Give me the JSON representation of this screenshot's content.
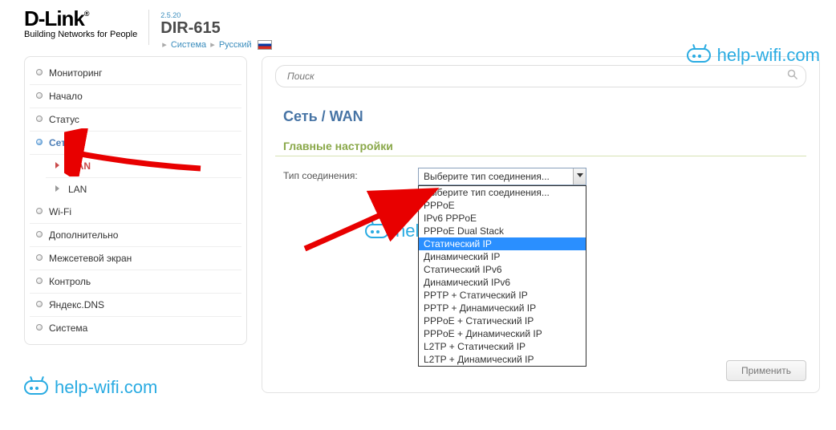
{
  "header": {
    "brand": "D-Link",
    "brand_reg": "®",
    "tagline": "Building Networks for People",
    "version": "2.5.20",
    "model": "DIR-615",
    "crumb1": "Система",
    "crumb2": "Русский"
  },
  "sidebar": {
    "items": [
      {
        "label": "Мониторинг"
      },
      {
        "label": "Начало"
      },
      {
        "label": "Статус"
      },
      {
        "label": "Сеть",
        "active": true
      },
      {
        "label": "Wi-Fi"
      },
      {
        "label": "Дополнительно"
      },
      {
        "label": "Межсетевой экран"
      },
      {
        "label": "Контроль"
      },
      {
        "label": "Яндекс.DNS"
      },
      {
        "label": "Система"
      }
    ],
    "sub": [
      {
        "label": "WAN",
        "active": true
      },
      {
        "label": "LAN"
      }
    ]
  },
  "search": {
    "placeholder": "Поиск"
  },
  "page": {
    "title": "Сеть /  WAN",
    "section": "Главные настройки",
    "conn_label": "Тип соединения:",
    "selected": "Выберите тип соединения...",
    "options": [
      "Выберите тип соединения...",
      "PPPoE",
      "IPv6 PPPoE",
      "PPPoE Dual Stack",
      "Статический IP",
      "Динамический IP",
      "Статический IPv6",
      "Динамический IPv6",
      "PPTP + Статический IP",
      "PPTP + Динамический IP",
      "PPPoE + Статический IP",
      "PPPoE + Динамический IP",
      "L2TP + Статический IP",
      "L2TP + Динамический IP"
    ],
    "apply": "Применить"
  },
  "watermark": "help-wifi.com"
}
